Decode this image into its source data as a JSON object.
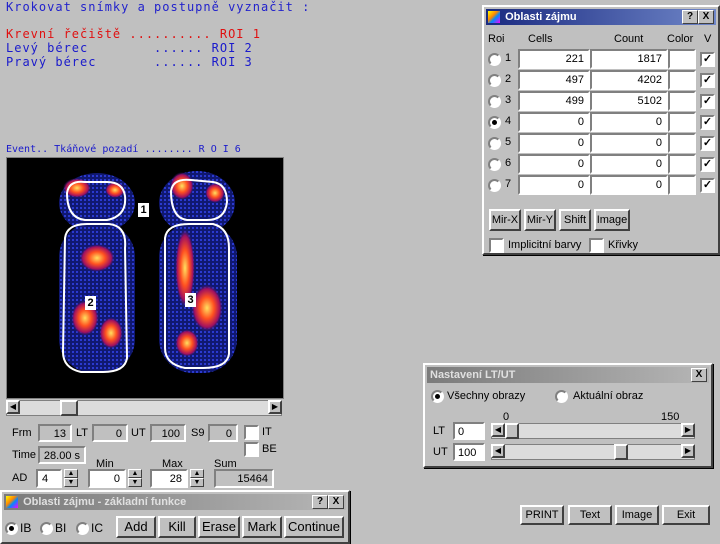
{
  "instructions": {
    "heading": "Krokovat snímky a postupně vyznačit :",
    "line1": "Krevní řečiště .......... ROI 1",
    "line2": "Levý bérec        ...... ROI 2",
    "line3": "Pravý bérec       ...... ROI 3",
    "eventual": "Event.. Tkáňové pozadí ........ R O I 6",
    "heading_color": "#2222cc",
    "roi1_color": "#e01010",
    "roi_color": "#1a1acc"
  },
  "roi_labels": {
    "r1": "1",
    "r2": "2",
    "r3": "3"
  },
  "roi_window": {
    "title": "Oblasti zájmu",
    "help": "?",
    "close": "X",
    "headers": {
      "roi": "Roi",
      "cells": "Cells",
      "count": "Count",
      "color": "Color",
      "v": "V"
    },
    "rows": [
      {
        "n": "1",
        "cells": "221",
        "count": "1817",
        "sel": false,
        "v": true
      },
      {
        "n": "2",
        "cells": "497",
        "count": "4202",
        "sel": false,
        "v": true
      },
      {
        "n": "3",
        "cells": "499",
        "count": "5102",
        "sel": false,
        "v": true
      },
      {
        "n": "4",
        "cells": "0",
        "count": "0",
        "sel": true,
        "v": true
      },
      {
        "n": "5",
        "cells": "0",
        "count": "0",
        "sel": false,
        "v": true
      },
      {
        "n": "6",
        "cells": "0",
        "count": "0",
        "sel": false,
        "v": true
      },
      {
        "n": "7",
        "cells": "0",
        "count": "0",
        "sel": false,
        "v": true
      }
    ],
    "buttons": {
      "mirx": "Mir-X",
      "miry": "Mir-Y",
      "shift": "Shift",
      "image": "Image"
    },
    "implicit": "Implicitní barvy",
    "curves": "Křivky"
  },
  "lt_window": {
    "title": "Nastavení LT/UT",
    "close": "X",
    "all_images": "Všechny obrazy",
    "current_image": "Aktuální obraz",
    "scale_min": "0",
    "scale_max": "150",
    "lt_label": "LT",
    "lt_value": "0",
    "ut_label": "UT",
    "ut_value": "100",
    "lt_level": 0,
    "ut_level": 0.67
  },
  "controls": {
    "frm_label": "Frm",
    "frm_value": "13",
    "lt_label": "LT",
    "lt_value": "0",
    "ut_label": "UT",
    "ut_value": "100",
    "s9_label": "S9",
    "s9_value": "0",
    "it_label": "IT",
    "be_label": "BE",
    "time_label": "Time",
    "time_value": "28.00 s",
    "min_label": "Min",
    "max_label": "Max",
    "sum_label": "Sum",
    "ad_label": "AD",
    "ad_value": "4",
    "min_value": "0",
    "max_value": "28",
    "sum_value": "15464"
  },
  "bottom_window": {
    "title": "Oblasti zájmu - základní funkce",
    "help": "?",
    "close": "X",
    "ib": "IB",
    "bi": "BI",
    "ic": "IC",
    "add": "Add",
    "kill": "Kill",
    "erase": "Erase",
    "mark": "Mark",
    "continue": "Continue"
  },
  "footer_buttons": {
    "print": "PRINT",
    "text": "Text",
    "image": "Image",
    "exit": "Exit"
  }
}
